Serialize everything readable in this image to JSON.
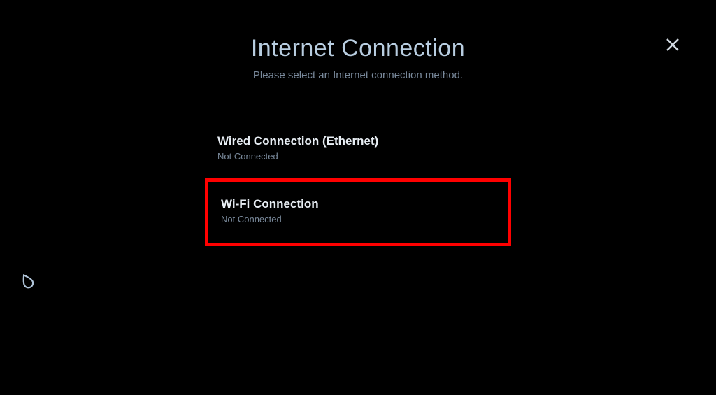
{
  "header": {
    "title": "Internet Connection",
    "subtitle": "Please select an Internet connection method."
  },
  "options": [
    {
      "title": "Wired Connection (Ethernet)",
      "status": "Not Connected",
      "highlighted": false
    },
    {
      "title": "Wi-Fi Connection",
      "status": "Not Connected",
      "highlighted": true
    }
  ],
  "icons": {
    "close": "close-icon",
    "water": "water-drop-icon"
  }
}
